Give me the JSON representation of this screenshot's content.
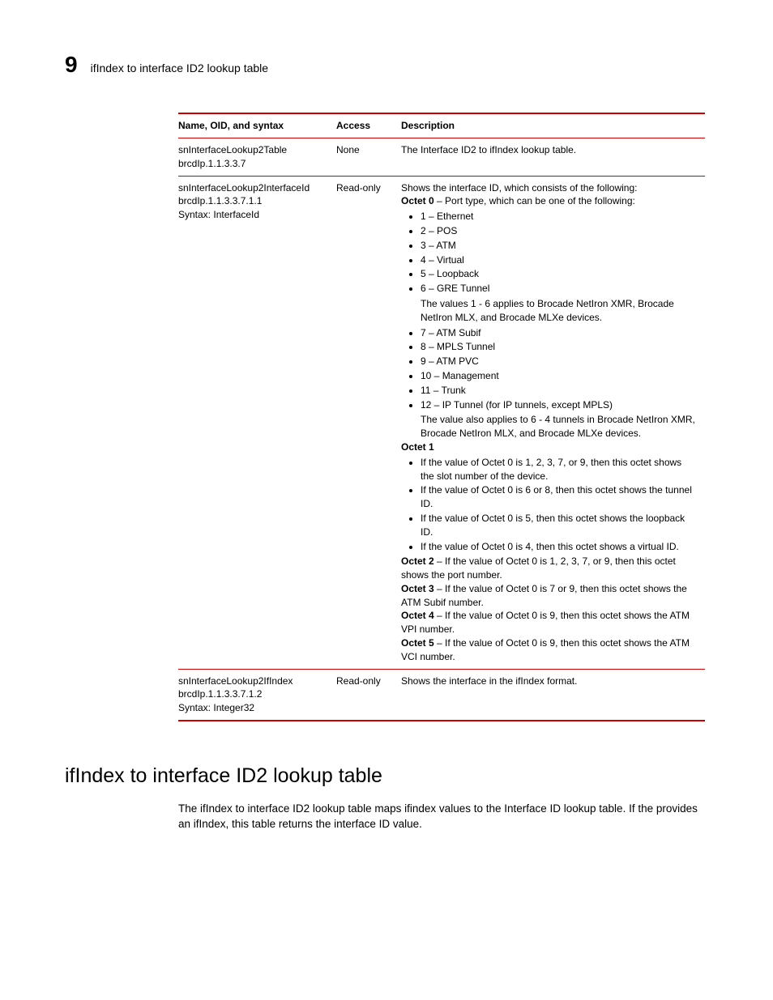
{
  "header": {
    "chapter_number": "9",
    "running_title": "ifIndex to interface ID2 lookup table"
  },
  "table": {
    "headers": {
      "name": "Name, OID, and syntax",
      "access": "Access",
      "desc": "Description"
    },
    "rows": [
      {
        "name_l1": "snInterfaceLookup2Table",
        "name_l2": "brcdIp.1.1.3.3.7",
        "name_l3": "",
        "access": "None",
        "desc_simple": "The Interface ID2 to ifIndex lookup table."
      },
      {
        "name_l1": "snInterfaceLookup2InterfaceId",
        "name_l2": "brcdIp.1.1.3.3.7.1.1",
        "name_l3": "Syntax: InterfaceId",
        "access": "Read-only",
        "intro": "Shows the interface ID, which consists of the following:",
        "octet0_label": "Octet 0",
        "octet0_intro": " – Port type, which can be one of the following:",
        "octet0_list": [
          "1 – Ethernet",
          "2 – POS",
          "3 – ATM",
          "4 – Virtual",
          "5 – Loopback",
          "6 – GRE Tunnel"
        ],
        "octet0_note": "The values 1 - 6 applies to Brocade NetIron XMR, Brocade NetIron MLX, and Brocade MLXe devices.",
        "octet0_list2": [
          "7 – ATM Subif",
          "8 – MPLS Tunnel",
          "9 – ATM PVC",
          "10 – Management",
          "11 – Trunk",
          "12 – IP Tunnel (for IP tunnels, except MPLS)"
        ],
        "octet0_note2": "The value also applies to 6 - 4 tunnels in Brocade NetIron XMR, Brocade NetIron MLX, and Brocade MLXe devices.",
        "octet1_label": "Octet 1",
        "octet1_list": [
          "If the value of Octet 0 is 1, 2, 3, 7, or 9, then this octet shows the slot number of the device.",
          "If the value of Octet 0 is 6 or 8, then this octet shows the tunnel ID.",
          "If the value of Octet 0 is 5, then this octet shows the loopback ID.",
          "If the value of Octet 0 is 4, then this octet shows a virtual ID."
        ],
        "octet2_label": "Octet 2",
        "octet2_text": " – If the value of Octet 0 is 1, 2, 3, 7, or 9, then this octet shows the port number.",
        "octet3_label": "Octet 3",
        "octet3_text": " – If the value of Octet 0 is 7 or 9, then this octet shows the ATM Subif number.",
        "octet4_label": "Octet 4",
        "octet4_text": " – If the value of Octet 0 is 9, then this octet shows the ATM VPI number.",
        "octet5_label": "Octet 5",
        "octet5_text": " – If the value of Octet 0 is 9, then this octet shows the ATM VCI number."
      },
      {
        "name_l1": "snInterfaceLookup2IfIndex",
        "name_l2": "brcdIp.1.1.3.3.7.1.2",
        "name_l3": "Syntax: Integer32",
        "access": "Read-only",
        "desc_simple": "Shows the interface in the ifIndex format."
      }
    ]
  },
  "section": {
    "heading": "ifIndex to interface ID2 lookup table",
    "body": "The ifIndex to interface ID2 lookup table maps ifindex values to the Interface ID lookup table. If the provides an ifIndex, this table returns the interface ID value."
  }
}
